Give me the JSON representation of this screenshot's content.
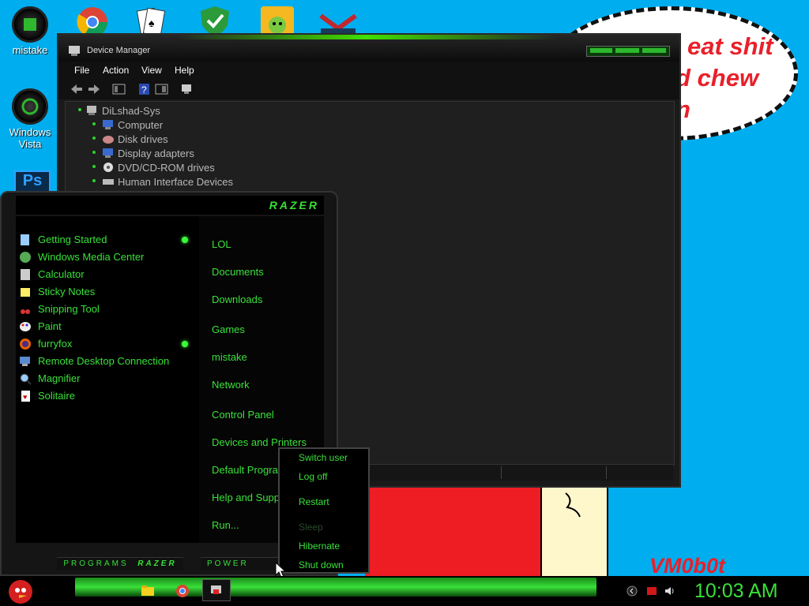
{
  "desktop": {
    "icons": [
      {
        "label": "mistake"
      },
      {
        "label": "Windows Vista"
      },
      {
        "label": "Ps"
      }
    ],
    "wallpaper": {
      "bubble_lines": [
        "...\"the other eat shit",
        "...d chew",
        "...n"
      ],
      "bubble_line1": "eat shit",
      "bubble_line2": "d chew",
      "bubble_line3": "n",
      "signature": "VM0b0t"
    }
  },
  "device_manager": {
    "title": "Device Manager",
    "menus": [
      "File",
      "Action",
      "View",
      "Help"
    ],
    "root": "DiLshad-Sys",
    "items": [
      {
        "label": "Computer"
      },
      {
        "label": "Disk drives"
      },
      {
        "label": "Display adapters"
      },
      {
        "label": "DVD/CD-ROM drives"
      },
      {
        "label": "Human Interface Devices"
      }
    ]
  },
  "start_menu": {
    "brand": "RAZER",
    "programs": [
      {
        "label": "Getting Started",
        "icon": "getting-started-icon"
      },
      {
        "label": "Windows Media Center",
        "icon": "media-center-icon"
      },
      {
        "label": "Calculator",
        "icon": "calculator-icon"
      },
      {
        "label": "Sticky Notes",
        "icon": "sticky-notes-icon"
      },
      {
        "label": "Snipping Tool",
        "icon": "snipping-tool-icon"
      },
      {
        "label": "Paint",
        "icon": "paint-icon"
      },
      {
        "label": "furryfox",
        "icon": "firefox-icon"
      },
      {
        "label": "Remote Desktop Connection",
        "icon": "remote-desktop-icon"
      },
      {
        "label": "Magnifier",
        "icon": "magnifier-icon"
      },
      {
        "label": "Solitaire",
        "icon": "solitaire-icon"
      }
    ],
    "places": [
      {
        "label": "LOL"
      },
      {
        "label": "Documents"
      },
      {
        "label": "Downloads"
      },
      {
        "label": "Games"
      },
      {
        "label": "mistake"
      },
      {
        "label": "Network"
      },
      {
        "label": "Control Panel"
      },
      {
        "label": "Devices and Printers"
      },
      {
        "label": "Default Programs"
      },
      {
        "label": "Help and Support"
      },
      {
        "label": "Run..."
      }
    ],
    "footer_programs": "PROGRAMS",
    "footer_brand": "RAZER",
    "footer_power": "POWER"
  },
  "power_menu": {
    "items": [
      {
        "label": "Switch user"
      },
      {
        "label": "Log off"
      },
      {
        "label": "Restart"
      },
      {
        "label": "Sleep"
      },
      {
        "label": "Hibernate"
      },
      {
        "label": "Shut down"
      }
    ]
  },
  "taskbar": {
    "clock": "10:03 AM"
  },
  "colors": {
    "desktop_bg": "#00aeef",
    "accent_green": "#39e039",
    "wallpaper_red": "#ee1d23"
  }
}
